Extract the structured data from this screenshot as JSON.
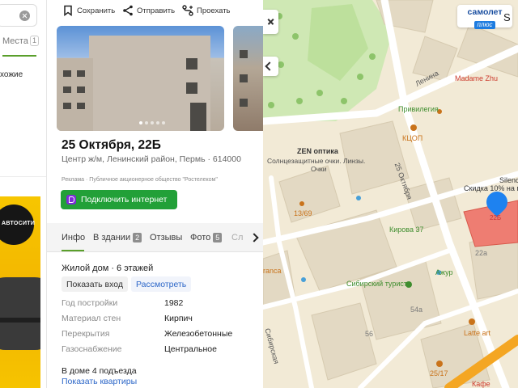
{
  "search": {
    "places_tab": "Места",
    "places_count": "1",
    "similar_text": "хожие"
  },
  "ad_banner": {
    "brand": "АВТОСИТИ"
  },
  "toolbar": {
    "save_label": "Сохранить",
    "share_label": "Отправить",
    "route_label": "Проехать"
  },
  "card": {
    "title": "25 Октября, 22Б",
    "subtitle": "Центр ж/м, Ленинский район, Пермь · 614000",
    "ad_line": "Реклама · Публичное акционерное общество \"Ростелеком\"",
    "connect_label": "Подключить интернет",
    "tabs": [
      {
        "label": "Инфо"
      },
      {
        "label": "В здании",
        "count": "2"
      },
      {
        "label": "Отзывы"
      },
      {
        "label": "Фото",
        "count": "5"
      },
      {
        "label": "Сл"
      }
    ],
    "house_type": "Жилой дом · 6 этажей",
    "show_entrance_label": "Показать вход",
    "view_label": "Рассмотреть",
    "properties": [
      {
        "key": "Год постройки",
        "value": "1982"
      },
      {
        "key": "Материал стен",
        "value": "Кирпич"
      },
      {
        "key": "Перекрытия",
        "value": "Железобетонные"
      },
      {
        "key": "Газоснабжение",
        "value": "Центральное"
      }
    ],
    "entrances": "В доме 4 подъезда",
    "show_flats": "Показать квартиры"
  },
  "map": {
    "samolet_top": "самолет",
    "samolet_bottom": "плюс",
    "labels": {
      "lenina": "Ленина",
      "oct25": "25 Октября",
      "sibirskaya": "Сибирская",
      "madame": "Madame Zhu",
      "privilegia": "Привилегия",
      "kcop": "КЦОП",
      "zen_title": "ZEN оптика",
      "zen_desc1": "Солнцезащитные очки. Линзы.",
      "zen_desc2": "Очки",
      "silence": "Silence",
      "discount": "Скидка 10% на п",
      "b1369": "13/69",
      "kirova": "Кирова 37",
      "sibturist": "Сибирский турист",
      "azhur": "Ажур",
      "latte": "Latte art",
      "b2517": "25/17",
      "b56": "56",
      "b54": "54а",
      "b22a": "22а",
      "ranca": "ranca",
      "cafe": "Кафе",
      "house": "22Б",
      "s": "S"
    }
  }
}
